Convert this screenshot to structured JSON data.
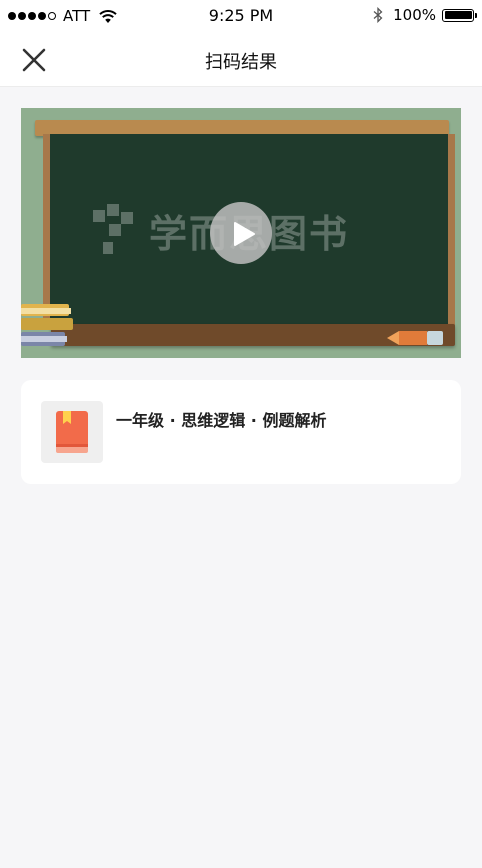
{
  "status_bar": {
    "carrier": "ATT",
    "time": "9:25 PM",
    "battery": "100%"
  },
  "nav": {
    "title": "扫码结果"
  },
  "video": {
    "watermark": "学而思图书"
  },
  "course": {
    "title": "一年级 · 思维逻辑 · 例题解析"
  },
  "colors": {
    "background": "#f6f6f8",
    "chalkboard": "#1f3a2c",
    "book_icon": "#f26b4a"
  }
}
